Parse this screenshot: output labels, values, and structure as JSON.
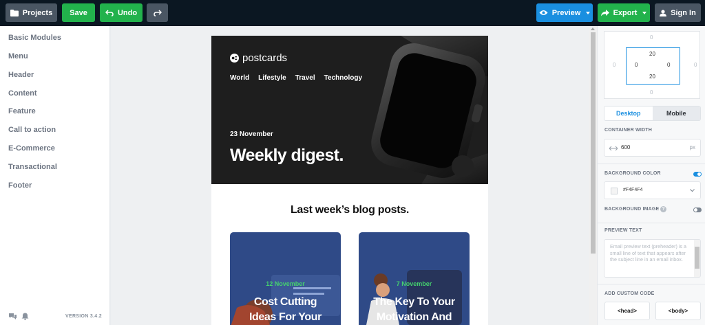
{
  "toolbar": {
    "projects_label": "Projects",
    "save_label": "Save",
    "undo_label": "Undo",
    "preview_label": "Preview",
    "export_label": "Export",
    "signin_label": "Sign In"
  },
  "sidebar": {
    "items": [
      {
        "label": "Basic Modules"
      },
      {
        "label": "Menu"
      },
      {
        "label": "Header"
      },
      {
        "label": "Content"
      },
      {
        "label": "Feature"
      },
      {
        "label": "Call to action"
      },
      {
        "label": "E-Commerce"
      },
      {
        "label": "Transactional"
      },
      {
        "label": "Footer"
      }
    ],
    "version": "VERSION 3.4.2"
  },
  "email": {
    "logo_text": "postcards",
    "nav": [
      "World",
      "Lifestyle",
      "Travel",
      "Technology"
    ],
    "hero_date": "23 November",
    "hero_title": "Weekly digest.",
    "section_title": "Last week’s blog posts.",
    "cards": [
      {
        "date": "12 November",
        "title_line1": "Cost Cutting",
        "title_line2": "Ideas For Your"
      },
      {
        "date": "7 November",
        "title_line1": "The Key To Your",
        "title_line2": "Motivation And"
      }
    ]
  },
  "panel": {
    "box_model": {
      "margin_top": "0",
      "margin_right": "0",
      "margin_bottom": "0",
      "margin_left": "0",
      "padding_top": "20",
      "padding_right": "0",
      "padding_bottom": "20",
      "padding_left": "0"
    },
    "device_tabs": {
      "desktop": "Desktop",
      "mobile": "Mobile",
      "selected": "Desktop"
    },
    "container_width_label": "CONTAINER WIDTH",
    "container_width_value": "600",
    "container_width_unit": "px",
    "background_color_label": "BACKGROUND COLOR",
    "background_color_enabled": true,
    "background_color_value": "#F4F4F4",
    "background_image_label": "BACKGROUND IMAGE",
    "background_image_enabled": false,
    "preview_text_label": "PREVIEW TEXT",
    "preview_text_placeholder": "Email preview text (preheader) is a small line of text that appears after the subject line in an email inbox.",
    "custom_code_label": "ADD CUSTOM CODE",
    "head_button": "<head>",
    "body_button": "<body>"
  },
  "colors": {
    "topbar": "#0b1722",
    "green": "#22b24c",
    "blue": "#1a8fe0",
    "grey_button": "#4a5663",
    "card_bg": "#2f4a87",
    "card_date": "#45d16e"
  }
}
